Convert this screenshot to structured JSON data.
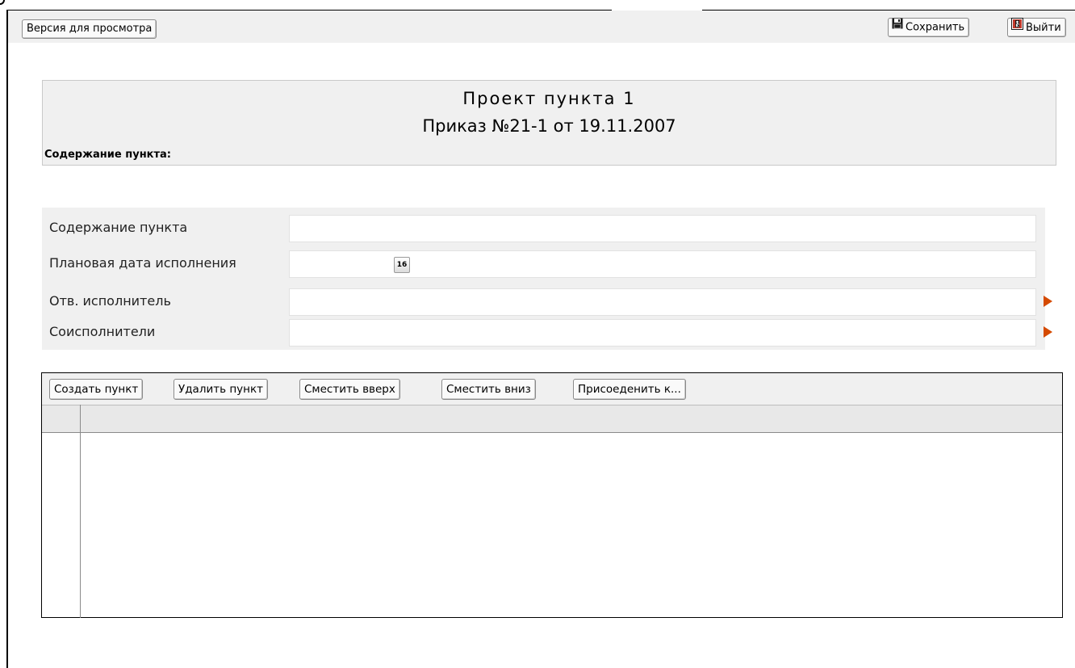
{
  "toolbar": {
    "preview_label": "Версия для просмотра",
    "save_label": "Сохранить",
    "exit_label": "Выйти"
  },
  "header": {
    "title": "Проект пункта 1",
    "order": "Приказ №21-1 от 19.11.2007",
    "caption": "Содержание пункта:"
  },
  "form": {
    "rows": [
      {
        "label": "Содержание пункта",
        "value": ""
      },
      {
        "label": "Плановая дата исполнения",
        "value": "",
        "date_icon_text": "16"
      },
      {
        "label": "Отв. исполнитель",
        "value": ""
      },
      {
        "label": "Соисполнители",
        "value": ""
      }
    ]
  },
  "items_toolbar": {
    "create_label": "Создать пункт",
    "delete_label": "Удалить пункт",
    "move_up_label": "Сместить вверх",
    "move_down_label": "Сместить вниз",
    "attach_label": "Присоеденить к..."
  },
  "colors": {
    "toolbar_bg": "#f0f0f0",
    "arrow_accent": "#d54a00"
  }
}
